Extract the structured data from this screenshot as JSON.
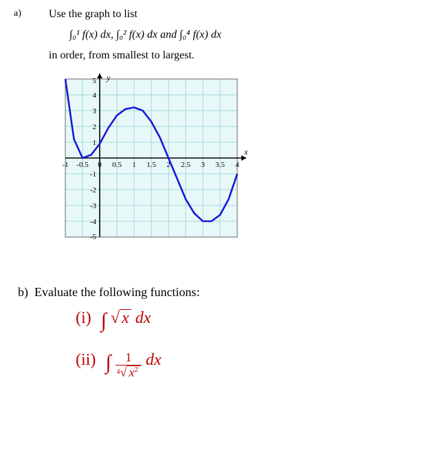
{
  "a": {
    "marker": "a)",
    "prompt": "Use the graph to list",
    "integral1": "∫₀¹ f(x) dx",
    "sep1": ", ",
    "integral2": "∫₀² f(x) dx",
    "sep2": " and ",
    "integral3": "∫₀⁴ f(x) dx",
    "followup": "in order, from smallest to largest."
  },
  "graph": {
    "x_ticks": [
      "-1",
      "-0.5",
      "0",
      "0.5",
      "1",
      "1.5",
      "2",
      "2.5",
      "3",
      "3.5",
      "4"
    ],
    "y_ticks_pos": [
      "1",
      "2",
      "3",
      "4",
      "5"
    ],
    "y_ticks_neg": [
      "-1",
      "-2",
      "-3",
      "-4",
      "-5"
    ],
    "x_label": "x",
    "y_label": "y"
  },
  "b": {
    "marker": "b)",
    "prompt": "Evaluate the following functions:",
    "i_label": "(i)",
    "i_math_int": "∫",
    "i_math_body": "√x dx",
    "ii_label": "(ii)",
    "ii_math_int": "∫",
    "ii_math_body_num": "1",
    "ii_root_index": "4",
    "ii_radicand": "x²",
    "ii_dx": " dx"
  },
  "chart_data": {
    "type": "line",
    "title": "",
    "xlabel": "x",
    "ylabel": "y",
    "xlim": [
      -1,
      4
    ],
    "ylim": [
      -5,
      5
    ],
    "grid": true,
    "x": [
      -1,
      -0.75,
      -0.5,
      -0.25,
      0,
      0.25,
      0.5,
      0.75,
      1,
      1.25,
      1.5,
      1.75,
      2,
      2.25,
      2.5,
      2.75,
      3,
      3.25,
      3.5,
      3.75,
      4
    ],
    "y": [
      5.0,
      1.2,
      0.0,
      0.2,
      0.9,
      1.9,
      2.7,
      3.1,
      3.2,
      3.0,
      2.3,
      1.3,
      0.0,
      -1.3,
      -2.6,
      -3.5,
      -4.0,
      -4.0,
      -3.6,
      -2.6,
      -1.0
    ]
  }
}
